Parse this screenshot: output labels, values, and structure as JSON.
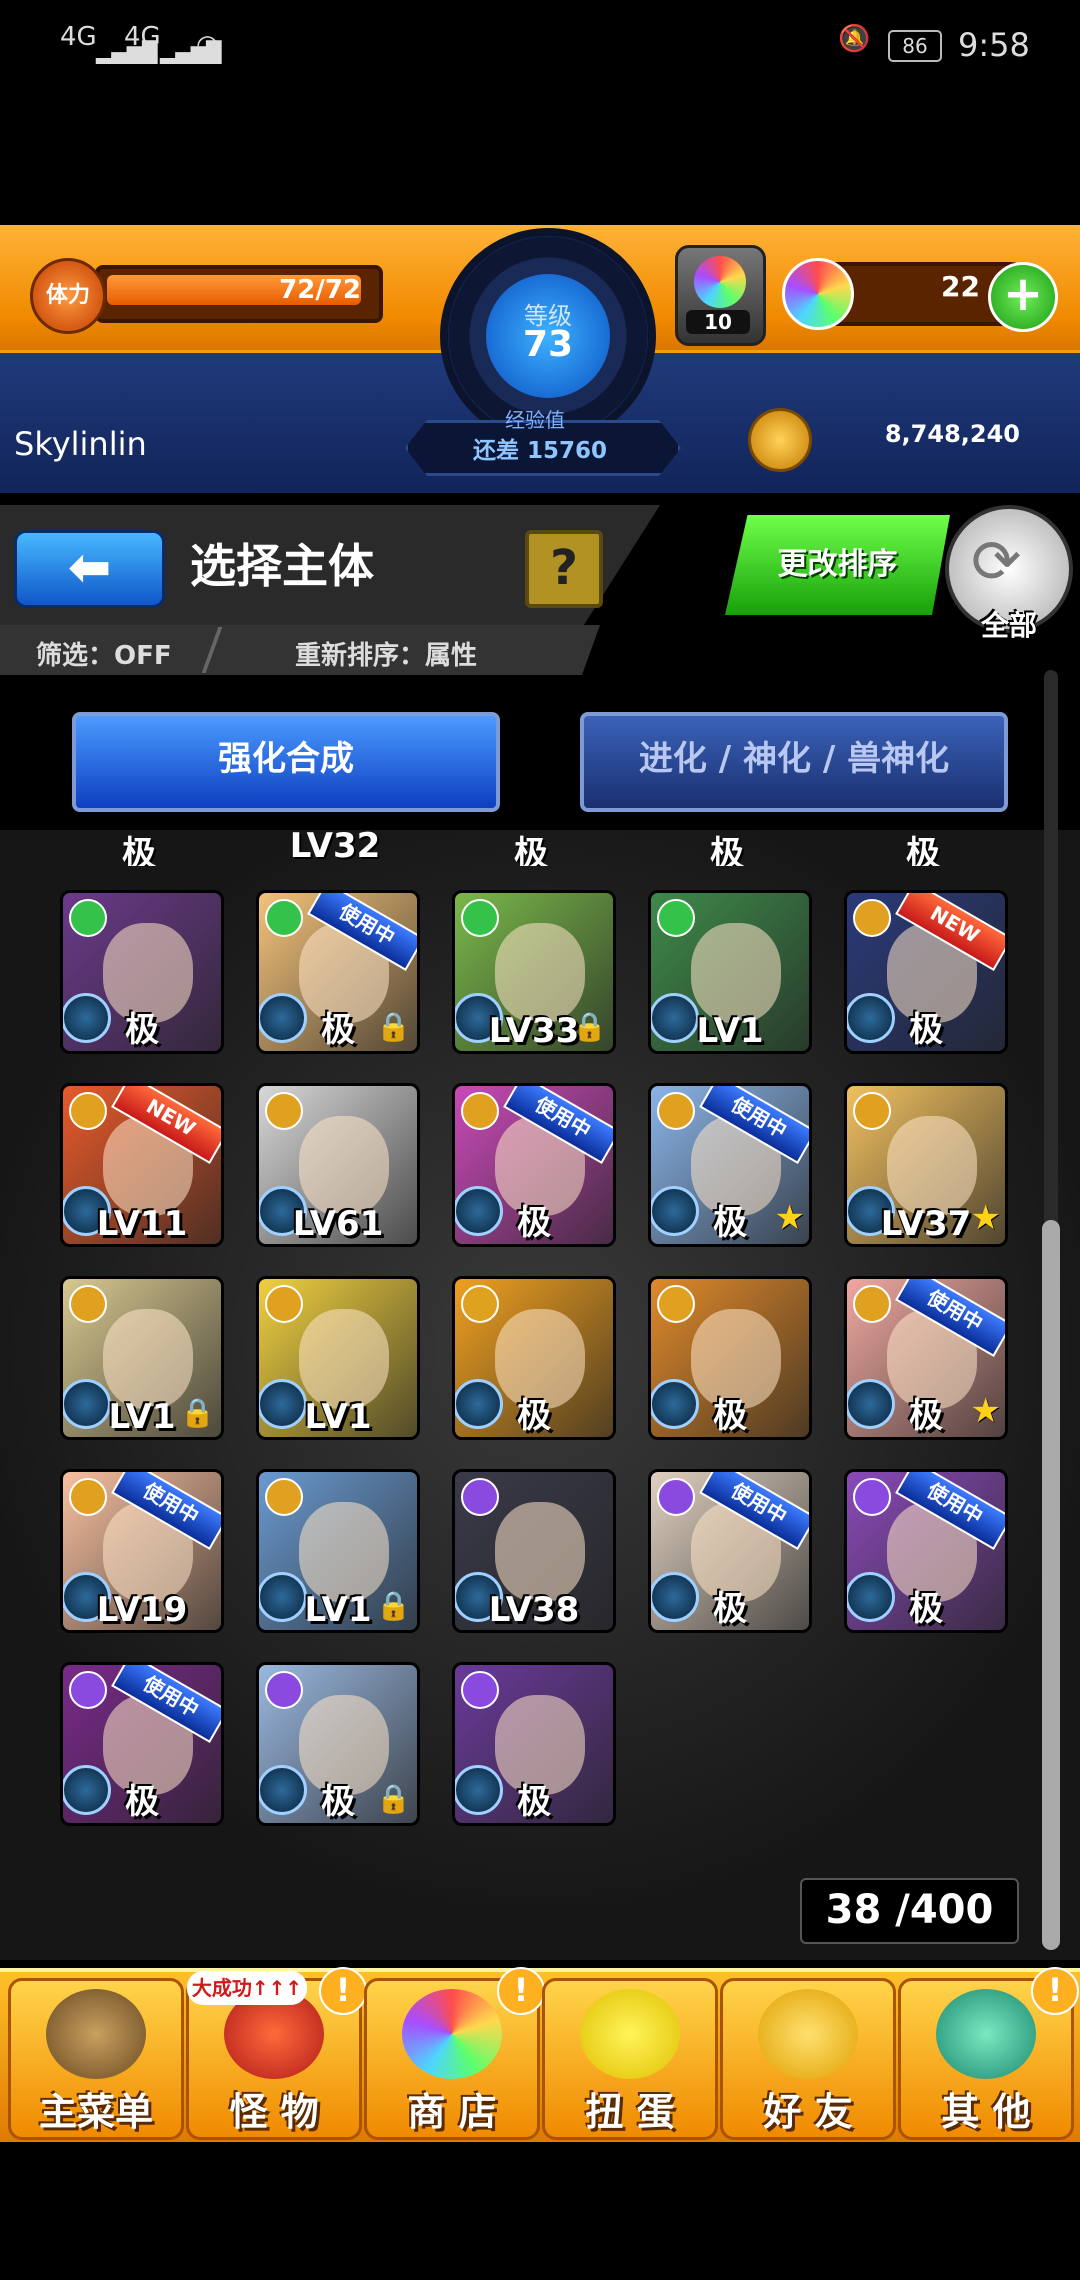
{
  "status_bar": {
    "signal1": "4G",
    "signal2": "4G",
    "battery": "86",
    "time": "9:58"
  },
  "player": {
    "stamina_label": "体力",
    "stamina": "72/72",
    "stamina_fraction": 1.0,
    "level_label": "等级",
    "level": "73",
    "exp_title": "经验值",
    "exp_remaining": "还差 15760",
    "medal_count": "10",
    "orbs": "22",
    "username": "Skylinlin",
    "coins": "8,748,240"
  },
  "header": {
    "back_symbol": "⬅",
    "title": "选择主体",
    "help_symbol": "?",
    "filter": "筛选：OFF",
    "sort": "重新排序：属性",
    "change_sort_button": "更改排序",
    "all_button": "全部"
  },
  "tabs": {
    "active": "强化合成",
    "inactive": "进化 / 神化 / 兽神化"
  },
  "partial_row": [
    "极",
    "LV32",
    "极",
    "极",
    "极"
  ],
  "cards": [
    {
      "label": "极",
      "element": "green",
      "bg": "#6b3a8a",
      "tag": "",
      "star": false,
      "lock": false
    },
    {
      "label": "极",
      "element": "green",
      "bg": "#f4c27a",
      "tag": "使用中",
      "star": false,
      "lock": true
    },
    {
      "label": "LV33",
      "element": "green",
      "bg": "#7ab84a",
      "tag": "",
      "star": false,
      "lock": true
    },
    {
      "label": "LV1",
      "element": "green",
      "bg": "#3e8a4a",
      "tag": "",
      "star": false,
      "lock": false
    },
    {
      "label": "极",
      "element": "gold",
      "bg": "#2a3a7a",
      "tag": "NEW",
      "star": false,
      "lock": false
    },
    {
      "label": "LV11",
      "element": "gold",
      "bg": "#e85a2a",
      "tag": "NEW",
      "star": false,
      "lock": false
    },
    {
      "label": "LV61",
      "element": "gold",
      "bg": "#d8d8d8",
      "tag": "",
      "star": false,
      "lock": false
    },
    {
      "label": "极",
      "element": "gold",
      "bg": "#c94ab8",
      "tag": "使用中",
      "star": false,
      "lock": false
    },
    {
      "label": "极",
      "element": "gold",
      "bg": "#8ab4e8",
      "tag": "使用中",
      "star": true,
      "lock": false
    },
    {
      "label": "LV37",
      "element": "gold",
      "bg": "#f0c060",
      "tag": "",
      "star": true,
      "lock": false
    },
    {
      "label": "LV1",
      "element": "gold",
      "bg": "#d8c890",
      "tag": "",
      "star": false,
      "lock": true
    },
    {
      "label": "LV1",
      "element": "gold",
      "bg": "#f0d040",
      "tag": "",
      "star": false,
      "lock": false
    },
    {
      "label": "极",
      "element": "gold",
      "bg": "#f0a020",
      "tag": "",
      "star": false,
      "lock": false
    },
    {
      "label": "极",
      "element": "gold",
      "bg": "#e08a2a",
      "tag": "",
      "star": false,
      "lock": false
    },
    {
      "label": "极",
      "element": "gold",
      "bg": "#f0a8a0",
      "tag": "使用中",
      "star": true,
      "lock": false
    },
    {
      "label": "LV19",
      "element": "gold",
      "bg": "#f8c0a0",
      "tag": "使用中",
      "star": false,
      "lock": false
    },
    {
      "label": "LV1",
      "element": "gold",
      "bg": "#6a9ad0",
      "tag": "",
      "star": false,
      "lock": true
    },
    {
      "label": "LV38",
      "element": "purple",
      "bg": "#3a3a4a",
      "tag": "",
      "star": false,
      "lock": false
    },
    {
      "label": "极",
      "element": "purple",
      "bg": "#e0d0c0",
      "tag": "使用中",
      "star": false,
      "lock": false
    },
    {
      "label": "极",
      "element": "purple",
      "bg": "#8a4ab8",
      "tag": "使用中",
      "star": false,
      "lock": false
    },
    {
      "label": "极",
      "element": "purple",
      "bg": "#7a2a8a",
      "tag": "使用中",
      "star": false,
      "lock": false
    },
    {
      "label": "极",
      "element": "purple",
      "bg": "#9ab8e0",
      "tag": "",
      "star": false,
      "lock": true
    },
    {
      "label": "极",
      "element": "purple",
      "bg": "#6a3a9a",
      "tag": "",
      "star": false,
      "lock": false
    }
  ],
  "element_colors": {
    "green": "#35c24a",
    "gold": "#e0a020",
    "purple": "#8a4ae0"
  },
  "counter": "38 /400",
  "bottom_nav": [
    {
      "label": "主菜单",
      "icon": "castle-icon",
      "alert": false,
      "promo": ""
    },
    {
      "label": "怪 物",
      "icon": "monster-icon",
      "alert": true,
      "promo": "大成功↑↑↑"
    },
    {
      "label": "商 店",
      "icon": "rainbow-orb-icon",
      "alert": true,
      "promo": ""
    },
    {
      "label": "扭 蛋",
      "icon": "gacha-egg-icon",
      "alert": false,
      "promo": ""
    },
    {
      "label": "好 友",
      "icon": "friends-icon",
      "alert": false,
      "promo": ""
    },
    {
      "label": "其 他",
      "icon": "other-icon",
      "alert": true,
      "promo": ""
    }
  ],
  "alert_symbol": "!"
}
